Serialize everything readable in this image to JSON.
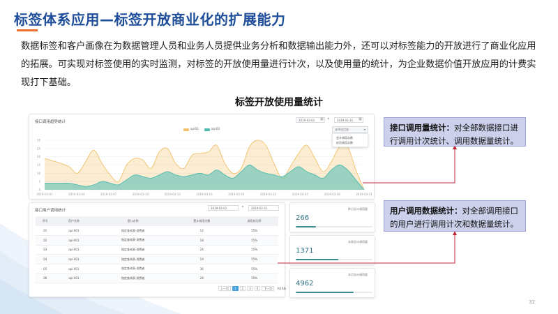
{
  "slide": {
    "title": "标签体系应用—标签开放商业化的扩展能力",
    "intro": "数据标签和客户画像在为数据管理人员和业务人员提供业务分析和数据输出能力外，还可以对标签能力的开放进行了商业化应用的拓展。可实现对标签使用的实时监测，对标签的开放使用量进行计次，以及使用量的统计，为企业数据价值开放应用的计费实现打下基础。",
    "section_heading": "标签开放使用量统计",
    "page_number": "32",
    "colors": {
      "title": "#1f4e9a",
      "accent": "#ee6f2d",
      "callout_bg": "#ccd0ea",
      "connector": "#c0263b"
    }
  },
  "api_chart_panel": {
    "title": "接口调用趋势统计",
    "date_from": "2019-03-01",
    "date_to": "2019-03-31",
    "dropdown_label": "选择调用量",
    "dropdown_options": [
      "会计调用次数",
      "成功调用次数"
    ]
  },
  "chart_data": {
    "type": "area",
    "series": [
      {
        "name": "api01",
        "color": "#f2c16b",
        "values": [
          19,
          17.5,
          16,
          14,
          10,
          17,
          24,
          16,
          9,
          5,
          15,
          19,
          18,
          13,
          23,
          25,
          16,
          13,
          21,
          22,
          23,
          27,
          16,
          10,
          13,
          26,
          30,
          27,
          16,
          7,
          14,
          22,
          27,
          19,
          11,
          17,
          26,
          26,
          12,
          0
        ]
      },
      {
        "name": "api02",
        "color": "#4cbcb0",
        "values": [
          4,
          4,
          4,
          4,
          3,
          2,
          3,
          5,
          4,
          3,
          6,
          9,
          8,
          7,
          9,
          11,
          9,
          8,
          9,
          10,
          9,
          12,
          9,
          7,
          11,
          15,
          12,
          10,
          9,
          8,
          11,
          14,
          11,
          9,
          7,
          12,
          15,
          12,
          6,
          0
        ]
      }
    ],
    "categories": [
      "2019-03-01",
      "2019-03-04",
      "2019-03-07",
      "2019-03-10",
      "2019-03-13",
      "2019-03-16",
      "2019-03-19",
      "2019-03-22",
      "2019-03-25",
      "2019-03-28",
      "2019-03-31"
    ],
    "y_ticks": [
      "0",
      "5",
      "10",
      "15",
      "20",
      "25",
      "30"
    ],
    "ylim": [
      0,
      30
    ],
    "grid": true,
    "legend_position": "top-center"
  },
  "user_panel": {
    "title": "接口用户调用统计",
    "date_from": "2019-03-01",
    "date_to": "2019-03-31",
    "columns": [
      "序号",
      "用户名称",
      "接口名称",
      "累计调用次数",
      "调用成功率"
    ],
    "rows": [
      [
        "01",
        "api-001",
        "指定查询表-消费者",
        "12",
        "55%"
      ],
      [
        "02",
        "api-001",
        "指定查询表-消费者",
        "18",
        "55%"
      ],
      [
        "03",
        "api-001",
        "指定查询表-消费者",
        "24",
        "55%"
      ],
      [
        "04",
        "api-001",
        "指定查询表-消费者",
        "19",
        "55%"
      ],
      [
        "05",
        "api-001",
        "指定查询表-消费者",
        "36",
        "55%"
      ],
      [
        "06",
        "api-001",
        "指定查询表-消费者",
        "24",
        "55%"
      ]
    ],
    "pager": {
      "prev": "上一页",
      "pages": [
        "1",
        "2",
        "3",
        "4"
      ],
      "active_index": 0,
      "next": "下一页",
      "total": "共10条"
    }
  },
  "stats": [
    {
      "label": "昨日总计调用量",
      "value": "266",
      "progress": 0.26
    },
    {
      "label": "本周总计调用量",
      "value": "1371",
      "progress": 0.55
    },
    {
      "label": "本月总计调用量",
      "value": "4962",
      "progress": 0.75
    }
  ],
  "callouts": {
    "api": {
      "bold": "接口调用量统计：",
      "text": "对全部数据接口进行调用计次统计、调用数据量统计。"
    },
    "user": {
      "bold": "用户调用数据统计：",
      "text": "对全部调用接口的用户进行调用计次和数据量统计。"
    }
  }
}
